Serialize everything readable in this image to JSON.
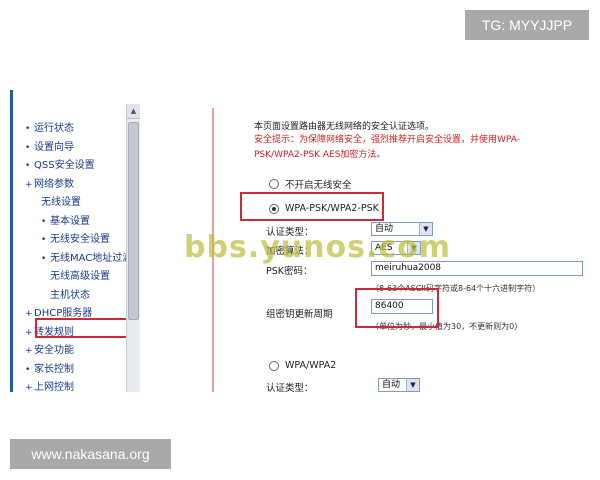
{
  "overlay": {
    "top_badge": "TG: MYYJJPP",
    "bottom_badge": "www.nakasana.org",
    "watermark": "bbs.yunos.com"
  },
  "sidebar": {
    "items": [
      {
        "label": "运行状态",
        "level": 1
      },
      {
        "label": "设置向导",
        "level": 1
      },
      {
        "label": "QSS安全设置",
        "level": 1
      },
      {
        "label": "网络参数",
        "level": 1
      },
      {
        "label": "无线设置",
        "level": 1
      },
      {
        "label": "基本设置",
        "level": 2
      },
      {
        "label": "无线安全设置",
        "level": 2,
        "selected": true
      },
      {
        "label": "无线MAC地址过滤",
        "level": 2
      },
      {
        "label": "无线高级设置",
        "level": 2
      },
      {
        "label": "主机状态",
        "level": 2
      },
      {
        "label": "DHCP服务器",
        "level": 1
      },
      {
        "label": "转发规则",
        "level": 1
      },
      {
        "label": "安全功能",
        "level": 1
      },
      {
        "label": "家长控制",
        "level": 1
      },
      {
        "label": "上网控制",
        "level": 1
      }
    ]
  },
  "content": {
    "intro": "本页面设置路由器无线网络的安全认证选项。",
    "warning_line1": "安全提示：为保障网络安全，强烈推荐开启安全设置，并使用WPA-",
    "warning_line2": "PSK/WPA2-PSK AES加密方法。",
    "option_none": "不开启无线安全",
    "option_wpa_psk": "WPA-PSK/WPA2-PSK",
    "auth_type_label": "认证类型：",
    "auth_type_value": "自动",
    "encrypt_label": "加密算法：",
    "encrypt_value": "AES",
    "psk_label": "PSK密码：",
    "psk_value": "meiruhua2008",
    "psk_hint": "（8-63个ASCII码字符或8-64个十六进制字符）",
    "group_key_label": "组密钥更新周期",
    "group_key_value": "86400",
    "group_key_hint": "（单位为秒，最小值为30，不更新则为0）",
    "option_wpa": "WPA/WPA2",
    "auth_type2_label": "认证类型：",
    "auth_type2_value": "自动",
    "wpa_psk_selected": true
  }
}
